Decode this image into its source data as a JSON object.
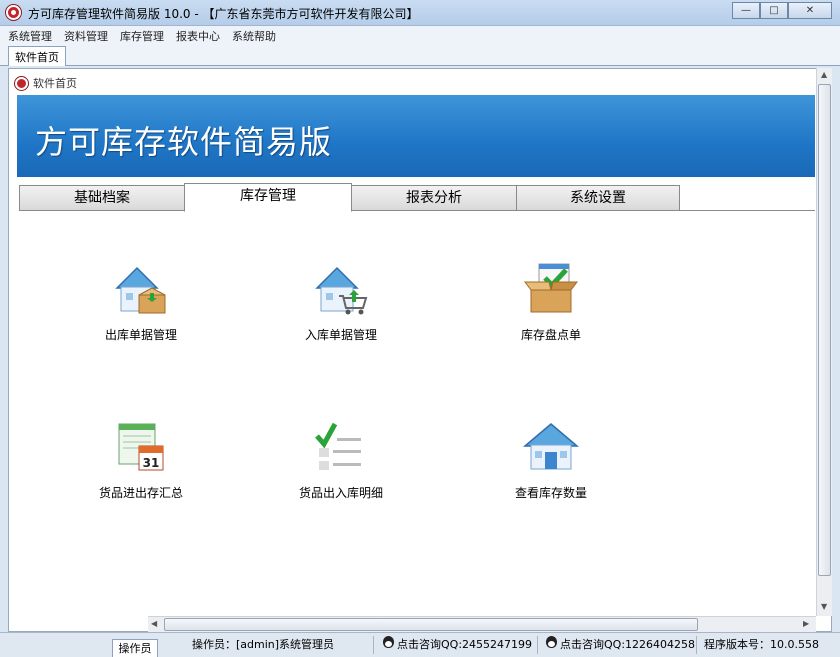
{
  "window": {
    "title": "方可库存管理软件简易版 10.0 - 【广东省东莞市方可软件开发有限公司】",
    "buttons": {
      "minimize": "—",
      "maximize": "□",
      "close": "✕"
    }
  },
  "menu": [
    "系统管理",
    "资料管理",
    "库存管理",
    "报表中心",
    "系统帮助"
  ],
  "doc_tab": "软件首页",
  "breadcrumb": "软件首页",
  "banner_title": "方可库存软件简易版",
  "tabs": [
    {
      "label": "基础档案",
      "active": false
    },
    {
      "label": "库存管理",
      "active": true
    },
    {
      "label": "报表分析",
      "active": false
    },
    {
      "label": "系统设置",
      "active": false
    }
  ],
  "modules": [
    {
      "label": "出库单据管理",
      "icon": "house-box-icon"
    },
    {
      "label": "入库单据管理",
      "icon": "house-cart-icon"
    },
    {
      "label": "库存盘点单",
      "icon": "box-check-icon"
    },
    {
      "label": "货品进出存汇总",
      "icon": "calendar-icon"
    },
    {
      "label": "货品出入库明细",
      "icon": "checklist-icon"
    },
    {
      "label": "查看库存数量",
      "icon": "house-icon"
    }
  ],
  "calendar_day": "31",
  "status": {
    "operator_tab": "操作员",
    "operator": "操作员：[admin]系统管理员",
    "qq1": "点击咨询QQ:2455247199",
    "qq2": "点击咨询QQ:1226404258",
    "version": "程序版本号：10.0.558"
  },
  "colors": {
    "banner": "#1f76c6",
    "titlebar": "#c9dcf2",
    "accent_red": "#c0262c"
  }
}
